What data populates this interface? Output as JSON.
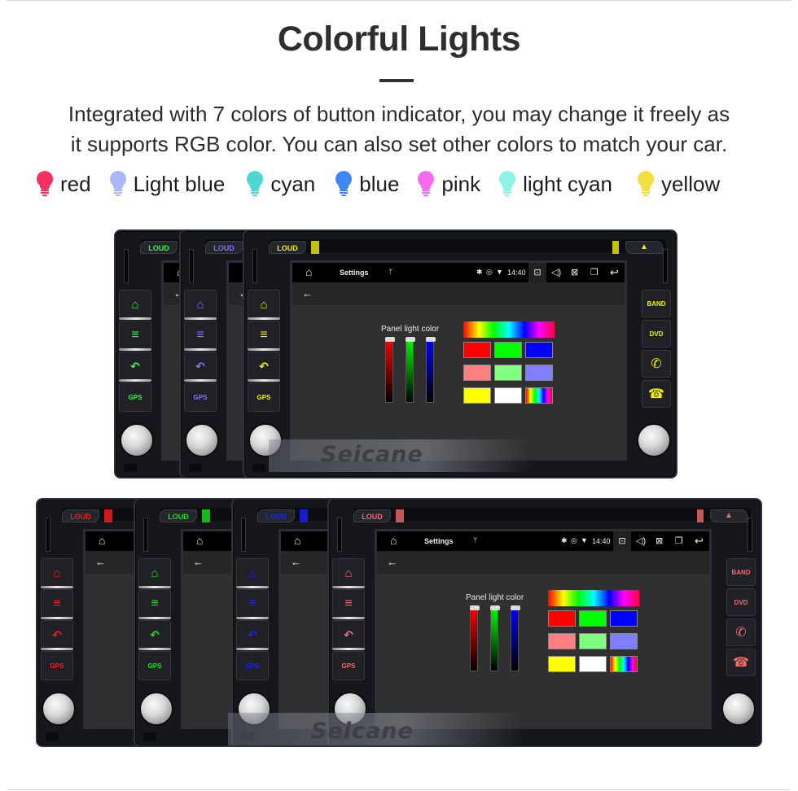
{
  "header": {
    "title": "Colorful Lights",
    "description_line1": "Integrated with 7 colors of button indicator, you may change it freely as",
    "description_line2": "it supports RGB color. You can also set other colors to match your car."
  },
  "legend": [
    {
      "label": "red",
      "color": "#f5325f"
    },
    {
      "label": "Light blue",
      "color": "#a9b9f7"
    },
    {
      "label": "cyan",
      "color": "#4fd8d2"
    },
    {
      "label": "blue",
      "color": "#3f86f5"
    },
    {
      "label": "pink",
      "color": "#f66af0"
    },
    {
      "label": "light cyan",
      "color": "#8ef5e6"
    },
    {
      "label": "yellow",
      "color": "#f2df3e"
    }
  ],
  "unit_buttons": {
    "loud": "LOUD",
    "gps": "GPS",
    "band": "BAND",
    "dvd": "DVD",
    "eject": "▲"
  },
  "screen": {
    "app_title": "Settings",
    "time": "14:40",
    "panel_label": "Panel light color",
    "spectrum_colors": [
      "#ff0000",
      "#ffff00",
      "#00ff00",
      "#00ffff",
      "#0000ff",
      "#ff00ff"
    ],
    "swatches": [
      "#ff0000",
      "#00ff00",
      "#0000ff",
      "#ff8080",
      "#80ff80",
      "#8080ff",
      "#ffff00",
      "#ffffff",
      "rainbow"
    ],
    "sliders": [
      {
        "channel": "red",
        "color": "#ff0000",
        "value": 1.0
      },
      {
        "channel": "green",
        "color": "#00ff00",
        "value": 1.0
      },
      {
        "channel": "blue",
        "color": "#0000ff",
        "value": 1.0
      }
    ]
  },
  "watermark": "Seicane",
  "top_row_units": [
    {
      "accent": "#3df046",
      "variant": "partial"
    },
    {
      "accent": "#7b78f5",
      "variant": "partial"
    },
    {
      "accent": "#f0f000",
      "variant": "full"
    }
  ],
  "bottom_row_units": [
    {
      "accent": "#ff1a1a",
      "variant": "partial"
    },
    {
      "accent": "#15e515",
      "variant": "partial"
    },
    {
      "accent": "#1a22ff",
      "variant": "partial"
    },
    {
      "accent": "#f26c6c",
      "variant": "full"
    }
  ]
}
